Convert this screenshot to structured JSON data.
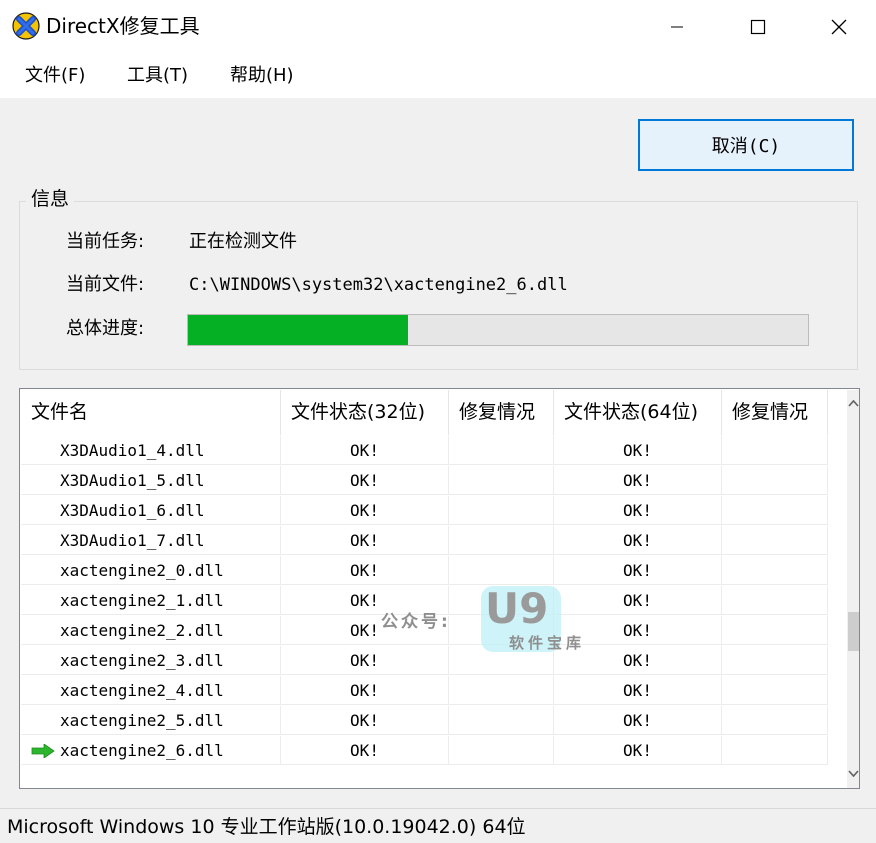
{
  "window": {
    "title": "DirectX修复工具"
  },
  "menu": [
    "文件(F)",
    "工具(T)",
    "帮助(H)"
  ],
  "cancel_button": "取消(C)",
  "info": {
    "group_title": "信息",
    "task_label": "当前任务:",
    "task_value": "正在检测文件",
    "file_label": "当前文件:",
    "file_value": "C:\\WINDOWS\\system32\\xactengine2_6.dll",
    "progress_label": "总体进度:",
    "progress_fraction": 0.355,
    "progress_color": "#06b025"
  },
  "table": {
    "columns": [
      "文件名",
      "文件状态(32位)",
      "修复情况",
      "文件状态(64位)",
      "修复情况"
    ],
    "rows": [
      {
        "name": "X3DAudio1_4.dll",
        "status32": "OK!",
        "repair32": "",
        "status64": "OK!",
        "repair64": ""
      },
      {
        "name": "X3DAudio1_5.dll",
        "status32": "OK!",
        "repair32": "",
        "status64": "OK!",
        "repair64": ""
      },
      {
        "name": "X3DAudio1_6.dll",
        "status32": "OK!",
        "repair32": "",
        "status64": "OK!",
        "repair64": ""
      },
      {
        "name": "X3DAudio1_7.dll",
        "status32": "OK!",
        "repair32": "",
        "status64": "OK!",
        "repair64": ""
      },
      {
        "name": "xactengine2_0.dll",
        "status32": "OK!",
        "repair32": "",
        "status64": "OK!",
        "repair64": ""
      },
      {
        "name": "xactengine2_1.dll",
        "status32": "OK!",
        "repair32": "",
        "status64": "OK!",
        "repair64": ""
      },
      {
        "name": "xactengine2_2.dll",
        "status32": "OK!",
        "repair32": "",
        "status64": "OK!",
        "repair64": ""
      },
      {
        "name": "xactengine2_3.dll",
        "status32": "OK!",
        "repair32": "",
        "status64": "OK!",
        "repair64": ""
      },
      {
        "name": "xactengine2_4.dll",
        "status32": "OK!",
        "repair32": "",
        "status64": "OK!",
        "repair64": ""
      },
      {
        "name": "xactengine2_5.dll",
        "status32": "OK!",
        "repair32": "",
        "status64": "OK!",
        "repair64": ""
      },
      {
        "name": "xactengine2_6.dll",
        "status32": "OK!",
        "repair32": "",
        "status64": "OK!",
        "repair64": "",
        "current": true
      }
    ],
    "current_row_icon": "green-right-arrow-icon"
  },
  "watermark": {
    "label": "公众号:",
    "logo": "U9",
    "subtitle": "软件宝库"
  },
  "status_bar": "Microsoft Windows 10 专业工作站版(10.0.19042.0) 64位",
  "icons": {
    "app": "directx-x-icon",
    "minimize": "minimize-icon",
    "maximize": "maximize-icon",
    "close": "close-icon",
    "scroll_up": "chevron-up-icon",
    "scroll_down": "chevron-down-icon"
  },
  "colors": {
    "accent": "#0078d7",
    "button_bg": "#e5f1fb",
    "app_icon_yellow": "#f5c400",
    "app_icon_blue": "#1e50c8"
  }
}
